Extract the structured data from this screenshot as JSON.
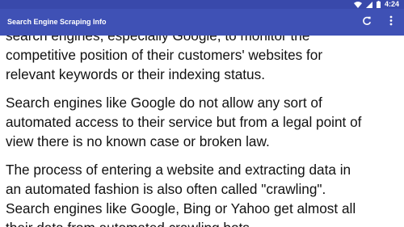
{
  "status_bar": {
    "wifi_icon": "wifi-icon",
    "signal_icon": "cell-signal-icon",
    "battery_icon": "battery-icon",
    "time": "4:24"
  },
  "app_bar": {
    "title": "Search Engine Scraping Info",
    "refresh_icon": "refresh-icon",
    "menu_icon": "overflow-menu-icon"
  },
  "colors": {
    "status_bar": "#3949ab",
    "app_bar": "#3f51b5",
    "text": "#111111",
    "background": "#ffffff"
  },
  "content": {
    "paragraphs": [
      {
        "lines": [
          "search engines, especially Google, to monitor the",
          "competitive position of their customers' websites for",
          "relevant keywords or their indexing status."
        ]
      },
      {
        "lines": [
          "Search engines like Google do not allow any sort of",
          "automated access to their service but from a legal point of",
          "view there is no known case or broken law."
        ]
      },
      {
        "lines": [
          "The process of entering a website and extracting data in",
          "an automated fashion is also often called \"crawling\".",
          "Search engines like Google, Bing or Yahoo get almost all",
          "their data from automated crawling bots."
        ]
      }
    ]
  }
}
